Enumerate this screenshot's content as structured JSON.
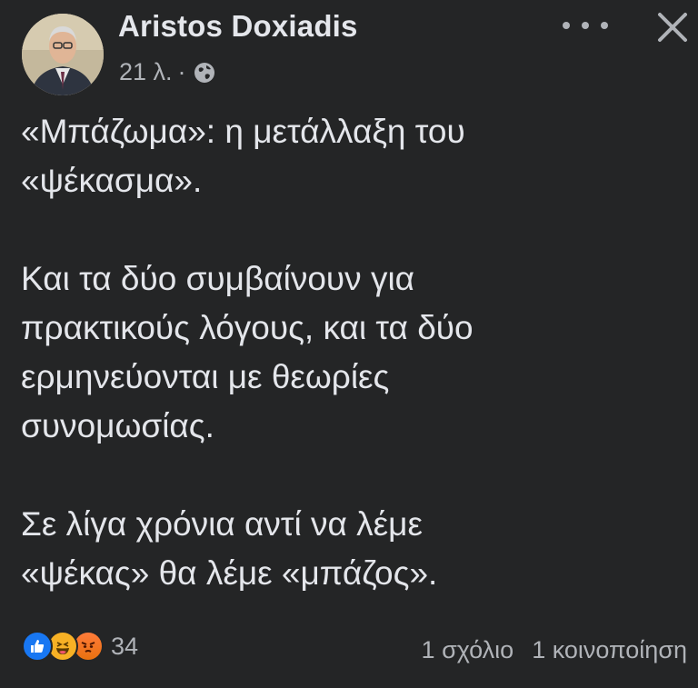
{
  "post": {
    "author": "Aristos Doxiadis",
    "time": "21 λ.",
    "separator": "·",
    "privacy_icon": "globe-icon",
    "paragraphs": [
      [
        "«Μπάζωμα»: η μετάλλαξη του",
        "«ψέκασμα»."
      ],
      [
        "Και τα δύο συμβαίνουν για",
        "πρακτικούς λόγους, και τα δύο",
        "ερμηνεύονται με θεωρίες",
        "συνομωσίας."
      ],
      [
        "Σε λίγα χρόνια αντί να λέμε",
        "«ψέκας» θα λέμε «μπάζος»."
      ]
    ]
  },
  "footer": {
    "reactions": [
      "like-icon",
      "haha-icon",
      "angry-icon"
    ],
    "reaction_count": "34",
    "comments": "1 σχόλιο",
    "shares": "1 κοινοποίηση"
  },
  "colors": {
    "background": "#242526",
    "text": "#e4e6eb",
    "secondary_text": "#b0b3b8",
    "like": "#1877f2",
    "haha": "#f7b125",
    "angry": "#e9710f"
  }
}
